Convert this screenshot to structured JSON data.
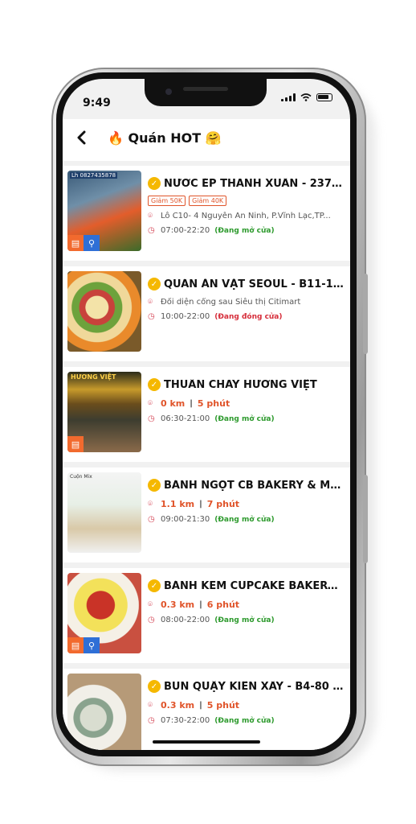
{
  "status_bar": {
    "time": "9:49"
  },
  "header": {
    "back_icon": "‹",
    "title": "Quán HOT",
    "fire_emoji": "🔥",
    "smile_emoji": "🤗"
  },
  "thumbs": {
    "t1_text": "Lh 0827435878",
    "t3_text": "HƯƠNG VIỆT",
    "t4_text": "Cuộn Mix"
  },
  "stores": [
    {
      "name": "NƯỚC ÉP THANH XUÂN - 237 N...",
      "promos": [
        "Giảm 50K",
        "Giảm 40K"
      ],
      "address": "Lô C10- 4 Nguyễn An Ninh, P.Vĩnh Lạc,TP...",
      "hours": "07:00-22:20",
      "status": "(Đang mở cửa)"
    },
    {
      "name": "QUÁN ĂN VẶT SEOUL - B11-19 L...",
      "address": "Đối diện cổng sau Siêu thị Citimart",
      "hours": "10:00-22:00",
      "status": "(Đang đóng cửa)"
    },
    {
      "name": "THUẦN CHAY HƯƠNG VIỆT",
      "distance": "0 km",
      "duration": "5 phút",
      "hours": "06:30-21:00",
      "status": "(Đang mở cửa)"
    },
    {
      "name": "BÁNH NGỌT CB BAKERY & MILK...",
      "distance": "1.1 km",
      "duration": "7 phút",
      "hours": "09:00-21:30",
      "status": "(Đang mở cửa)"
    },
    {
      "name": "BÁNH KEM CUPCAKE BAKERY - 3...",
      "distance": "0.3 km",
      "duration": "6 phút",
      "hours": "08:00-22:00",
      "status": "(Đang mở cửa)"
    },
    {
      "name": "BÚN QUẬY KIẾN XÂY - B4-80 3 T...",
      "distance": "0.3 km",
      "duration": "5 phút",
      "hours": "07:30-22:00",
      "status": "(Đang mở cửa)"
    }
  ],
  "separator": "|",
  "colors": {
    "accent": "#e0542a",
    "open": "#2d9a2d",
    "closed": "#d62d3a",
    "verified": "#f5b800"
  }
}
